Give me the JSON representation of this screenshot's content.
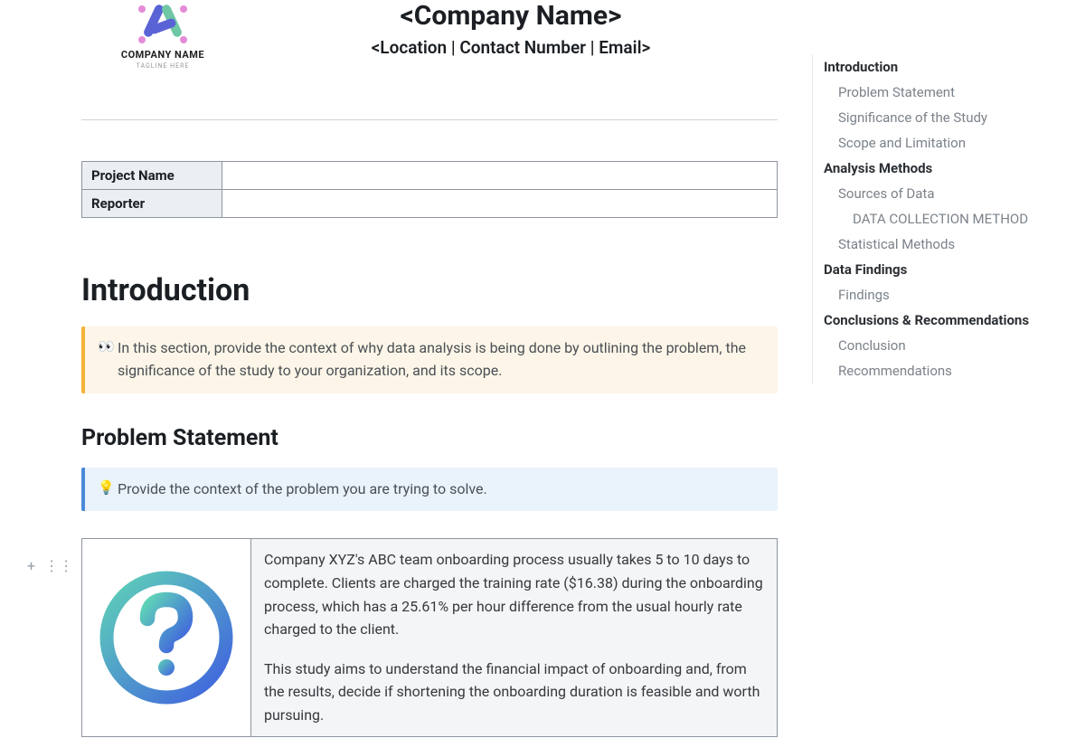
{
  "header": {
    "logo_name": "COMPANY NAME",
    "logo_tagline": "TAGLINE HERE",
    "company_name": "<Company Name>",
    "contact_line": "<Location | Contact Number | Email>"
  },
  "meta_table": {
    "rows": [
      {
        "label": "Project Name",
        "value": ""
      },
      {
        "label": "Reporter",
        "value": ""
      }
    ]
  },
  "sections": {
    "introduction_title": "Introduction",
    "introduction_callout": "In this section, provide the context of why data analysis is being done by outlining the problem, the significance of the study to your organization, and its scope.",
    "problem_statement_title": "Problem Statement",
    "problem_statement_callout": "Provide the context of the problem you are trying to solve."
  },
  "content": {
    "para1": "Company XYZ's ABC team onboarding process usually takes 5 to 10 days to complete. Clients are charged the training rate ($16.38) during the onboarding process, which has a 25.61% per hour difference from the usual hourly rate charged to the client.",
    "para2": "This study aims to understand the financial impact of onboarding and, from the results, decide if shortening the onboarding duration is feasible and worth pursuing."
  },
  "icons": {
    "eyes": "👀",
    "bulb": "💡",
    "plus": "+",
    "drag": "⋮⋮"
  },
  "outline": [
    {
      "level": 1,
      "label": "Introduction"
    },
    {
      "level": 2,
      "label": "Problem Statement"
    },
    {
      "level": 2,
      "label": "Significance of the Study"
    },
    {
      "level": 2,
      "label": "Scope and Limitation"
    },
    {
      "level": 1,
      "label": "Analysis Methods"
    },
    {
      "level": 2,
      "label": "Sources of Data"
    },
    {
      "level": 3,
      "label": "DATA COLLECTION METHOD"
    },
    {
      "level": 2,
      "label": "Statistical Methods"
    },
    {
      "level": 1,
      "label": "Data Findings"
    },
    {
      "level": 2,
      "label": "Findings"
    },
    {
      "level": 1,
      "label": "Conclusions & Recommendations"
    },
    {
      "level": 2,
      "label": "Conclusion"
    },
    {
      "level": 2,
      "label": "Recommendations"
    }
  ]
}
